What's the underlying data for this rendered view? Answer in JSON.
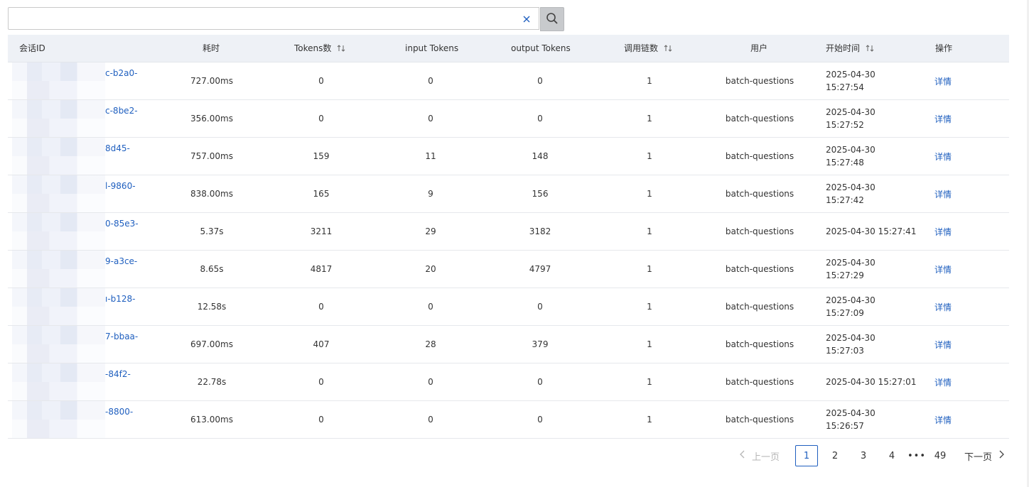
{
  "search": {
    "value": "",
    "placeholder": ""
  },
  "table": {
    "headers": {
      "session_id": "会话ID",
      "duration": "耗时",
      "tokens": "Tokens数",
      "input_tokens": "input Tokens",
      "output_tokens": "output Tokens",
      "chain_count": "调用链数",
      "user": "用户",
      "start_time": "开始时间",
      "action": "操作"
    },
    "rows": [
      {
        "session_tail": "c-b2a0-",
        "duration": "727.00ms",
        "tokens": "0",
        "input": "0",
        "output": "0",
        "chains": "1",
        "user": "batch-questions",
        "date": "2025-04-30",
        "time": "15:27:54",
        "action": "详情"
      },
      {
        "session_tail": "c-8be2-",
        "duration": "356.00ms",
        "tokens": "0",
        "input": "0",
        "output": "0",
        "chains": "1",
        "user": "batch-questions",
        "date": "2025-04-30",
        "time": "15:27:52",
        "action": "详情"
      },
      {
        "session_tail": "8d45-",
        "duration": "757.00ms",
        "tokens": "159",
        "input": "11",
        "output": "148",
        "chains": "1",
        "user": "batch-questions",
        "date": "2025-04-30",
        "time": "15:27:48",
        "action": "详情"
      },
      {
        "session_tail": "l-9860-",
        "duration": "838.00ms",
        "tokens": "165",
        "input": "9",
        "output": "156",
        "chains": "1",
        "user": "batch-questions",
        "date": "2025-04-30",
        "time": "15:27:42",
        "action": "详情"
      },
      {
        "session_tail": "0-85e3-",
        "duration": "5.37s",
        "tokens": "3211",
        "input": "29",
        "output": "3182",
        "chains": "1",
        "user": "batch-questions",
        "datetime": "2025-04-30 15:27:41",
        "action": "详情"
      },
      {
        "session_tail": "9-a3ce-",
        "duration": "8.65s",
        "tokens": "4817",
        "input": "20",
        "output": "4797",
        "chains": "1",
        "user": "batch-questions",
        "date": "2025-04-30",
        "time": "15:27:29",
        "action": "详情"
      },
      {
        "session_tail": "ı-b128-",
        "duration": "12.58s",
        "tokens": "0",
        "input": "0",
        "output": "0",
        "chains": "1",
        "user": "batch-questions",
        "date": "2025-04-30",
        "time": "15:27:09",
        "action": "详情"
      },
      {
        "session_tail": "7-bbaa-",
        "duration": "697.00ms",
        "tokens": "407",
        "input": "28",
        "output": "379",
        "chains": "1",
        "user": "batch-questions",
        "date": "2025-04-30",
        "time": "15:27:03",
        "action": "详情"
      },
      {
        "session_tail": "-84f2-",
        "duration": "22.78s",
        "tokens": "0",
        "input": "0",
        "output": "0",
        "chains": "1",
        "user": "batch-questions",
        "datetime": "2025-04-30 15:27:01",
        "action": "详情"
      },
      {
        "session_tail": "-8800-",
        "duration": "613.00ms",
        "tokens": "0",
        "input": "0",
        "output": "0",
        "chains": "1",
        "user": "batch-questions",
        "date": "2025-04-30",
        "time": "15:26:57",
        "action": "详情"
      }
    ]
  },
  "pagination": {
    "prev": "上一页",
    "pages": [
      "1",
      "2",
      "3",
      "4"
    ],
    "ellipsis": "•••",
    "last": "49",
    "next": "下一页",
    "current": 1
  },
  "icons": {
    "clear": "close-icon",
    "search": "search-icon",
    "sort": "sort-icon",
    "prev": "chevron-left-icon",
    "next": "chevron-right-icon"
  },
  "colors": {
    "link": "#1f5fbf",
    "header_bg": "#eef1f6",
    "search_button": "#c8cacd"
  }
}
